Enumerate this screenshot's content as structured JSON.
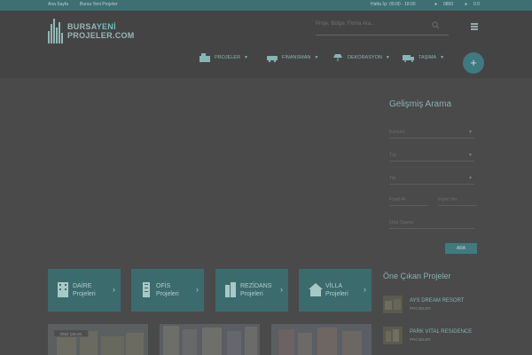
{
  "topbar": {
    "link1": "Ana Sayfa",
    "link2": "Bursa Yeni Projeler",
    "hours": "Hafta İçi: 09:00 - 18:00",
    "contact1": "0850",
    "contact2": "0 0"
  },
  "logo": {
    "line1a": "BURSA",
    "line1b": "YENİ",
    "line2": "PROJELER.COM"
  },
  "search": {
    "placeholder": "Proje, Bölge, Firma Ara..."
  },
  "nav": {
    "items": [
      {
        "label": "PROJELER",
        "icon": "building-icon"
      },
      {
        "label": "FİNANSMAN",
        "icon": "car-icon"
      },
      {
        "label": "DEKORASYON",
        "icon": "lamp-icon"
      },
      {
        "label": "TAŞIMA",
        "icon": "truck-icon"
      }
    ],
    "plus": "+"
  },
  "advanced_search": {
    "title": "Gelişmiş Arama",
    "fields": [
      "Konum",
      "Tür",
      "Tip"
    ],
    "price_min": "Fiyat Al",
    "price_max": "Fiyat Ver",
    "rooms": "Oda Sayısı",
    "button": "ARA"
  },
  "categories": [
    {
      "line1": "DAİRE",
      "line2": "Projeleri",
      "icon": "apartment-icon"
    },
    {
      "line1": "OFİS",
      "line2": "Projeleri",
      "icon": "office-icon"
    },
    {
      "line1": "REZİDANS",
      "line2": "Projeleri",
      "icon": "residence-icon"
    },
    {
      "line1": "VİLLA",
      "line2": "Projeleri",
      "icon": "villa-icon"
    }
  ],
  "featured": {
    "title": "Öne Çıkan Projeler",
    "items": [
      {
        "name": "AYS DREAM RESORT",
        "sub": "PROJELER"
      },
      {
        "name": "PARK VITAL RESIDENCE",
        "sub": "PROJELER"
      }
    ]
  },
  "listings": {
    "badge": "ÖNE ÇIKAN"
  },
  "colors": {
    "accent": "#3f7a7f",
    "overlay_bg": "#4a4a4a",
    "text_teal": "#8fb8b5"
  }
}
